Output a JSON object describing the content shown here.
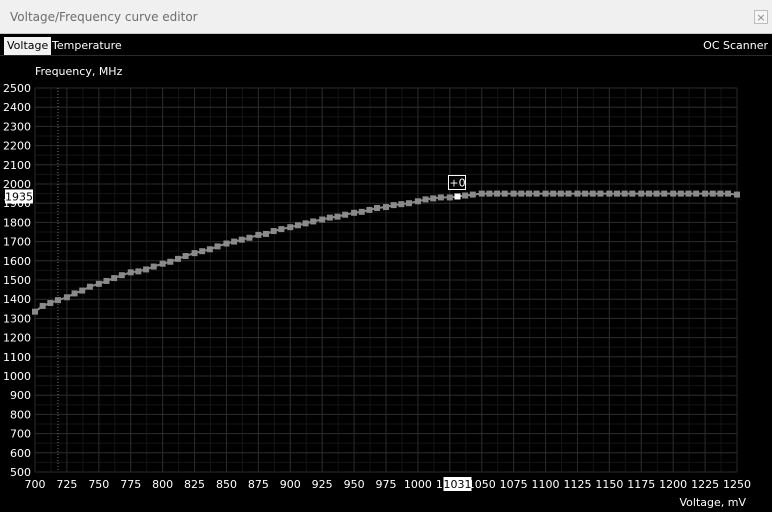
{
  "window": {
    "title": "Voltage/Frequency curve editor",
    "close_glyph": "×"
  },
  "tabs": [
    {
      "label": "Voltage",
      "active": true
    },
    {
      "label": "Temperature",
      "active": false
    }
  ],
  "oc_scanner_label": "OC Scanner",
  "chart_data": {
    "type": "scatter",
    "ylabel": "Frequency, MHz",
    "xlabel": "Voltage, mV",
    "xlim": [
      700,
      1250
    ],
    "ylim": [
      500,
      2500
    ],
    "x_ticks": [
      700,
      725,
      750,
      775,
      800,
      825,
      850,
      875,
      900,
      925,
      950,
      975,
      1000,
      1025,
      1050,
      1075,
      1100,
      1125,
      1150,
      1175,
      1200,
      1225,
      1250
    ],
    "y_ticks": [
      500,
      600,
      700,
      800,
      900,
      1000,
      1100,
      1200,
      1300,
      1400,
      1500,
      1600,
      1700,
      1800,
      1900,
      2000,
      2100,
      2200,
      2300,
      2400,
      2500
    ],
    "grid": true,
    "reference_line_voltage": 718,
    "selected_point": {
      "voltage": 1031,
      "frequency": 1935,
      "offset_label": "+0"
    },
    "x_cursor_label": "1031",
    "y_cursor_label": "1935",
    "series": [
      {
        "x": [
          700,
          706,
          712,
          718,
          725,
          731,
          737,
          743,
          750,
          756,
          762,
          768,
          775,
          781,
          787,
          793,
          800,
          806,
          812,
          818,
          825,
          831,
          837,
          843,
          850,
          856,
          862,
          868,
          875,
          881,
          887,
          893,
          900,
          906,
          912,
          918,
          925,
          931,
          937,
          943,
          950,
          956,
          962,
          968,
          975,
          981,
          987,
          993,
          1000,
          1006,
          1012,
          1018,
          1025,
          1031,
          1037,
          1043,
          1050,
          1056,
          1062,
          1068,
          1075,
          1081,
          1087,
          1093,
          1100,
          1106,
          1112,
          1118,
          1125,
          1131,
          1137,
          1143,
          1150,
          1156,
          1162,
          1168,
          1175,
          1181,
          1187,
          1193,
          1200,
          1206,
          1212,
          1218,
          1225,
          1231,
          1237,
          1243,
          1250
        ],
        "y": [
          1335,
          1365,
          1380,
          1395,
          1410,
          1430,
          1445,
          1465,
          1480,
          1495,
          1510,
          1525,
          1540,
          1545,
          1555,
          1570,
          1585,
          1595,
          1610,
          1625,
          1640,
          1650,
          1660,
          1675,
          1690,
          1700,
          1710,
          1720,
          1735,
          1740,
          1755,
          1765,
          1775,
          1785,
          1795,
          1805,
          1815,
          1825,
          1830,
          1840,
          1850,
          1855,
          1865,
          1875,
          1880,
          1890,
          1895,
          1900,
          1910,
          1920,
          1925,
          1930,
          1930,
          1935,
          1940,
          1945,
          1950,
          1950,
          1950,
          1950,
          1950,
          1950,
          1950,
          1950,
          1950,
          1950,
          1950,
          1950,
          1950,
          1950,
          1950,
          1950,
          1950,
          1950,
          1950,
          1950,
          1950,
          1950,
          1950,
          1950,
          1950,
          1950,
          1950,
          1950,
          1950,
          1950,
          1950,
          1950,
          1945
        ]
      }
    ]
  }
}
